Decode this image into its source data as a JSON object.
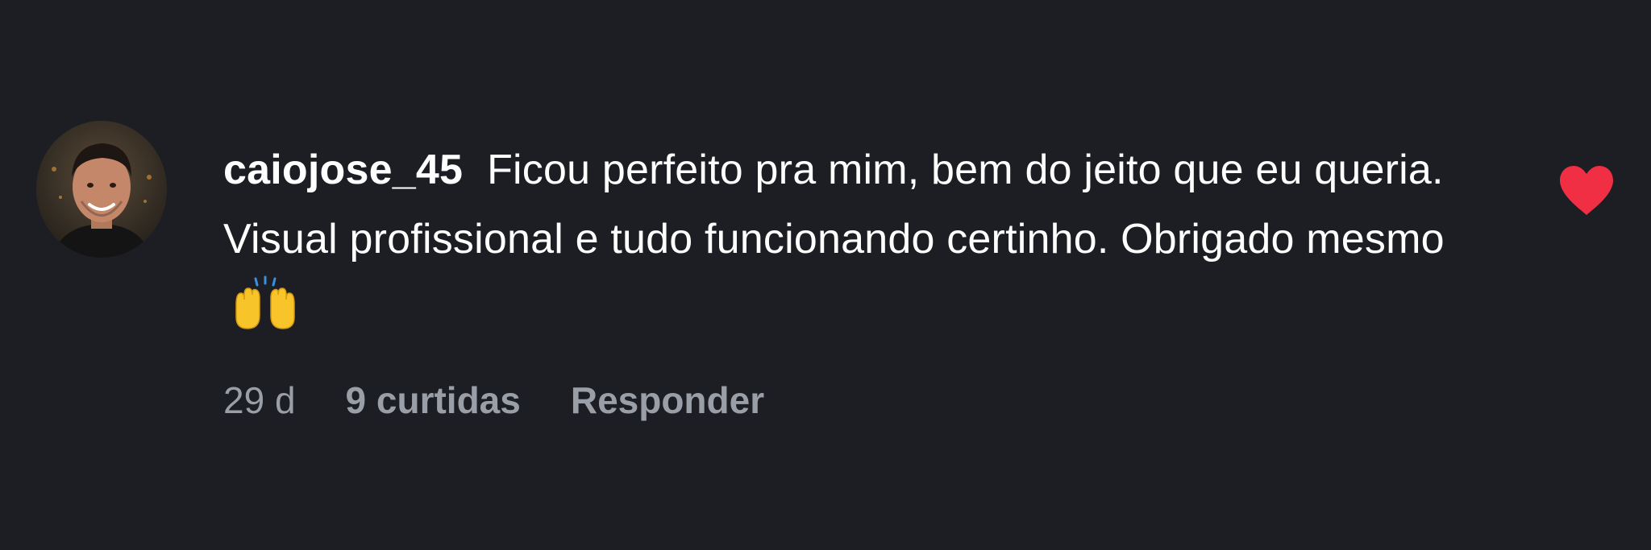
{
  "comment": {
    "username": "caiojose_45",
    "text": "Ficou perfeito pra mim, bem do jeito que eu queria. Visual profissional e tudo funcionando certinho. Obrigado mesmo",
    "emoji": "raising-hands-emoji",
    "age": "29 d",
    "likes": "9 curtidas",
    "reply_label": "Responder",
    "liked": true
  },
  "colors": {
    "background": "#1c1e24",
    "text": "#ffffff",
    "meta": "#9a9ea7",
    "heart": "#f02e44"
  }
}
